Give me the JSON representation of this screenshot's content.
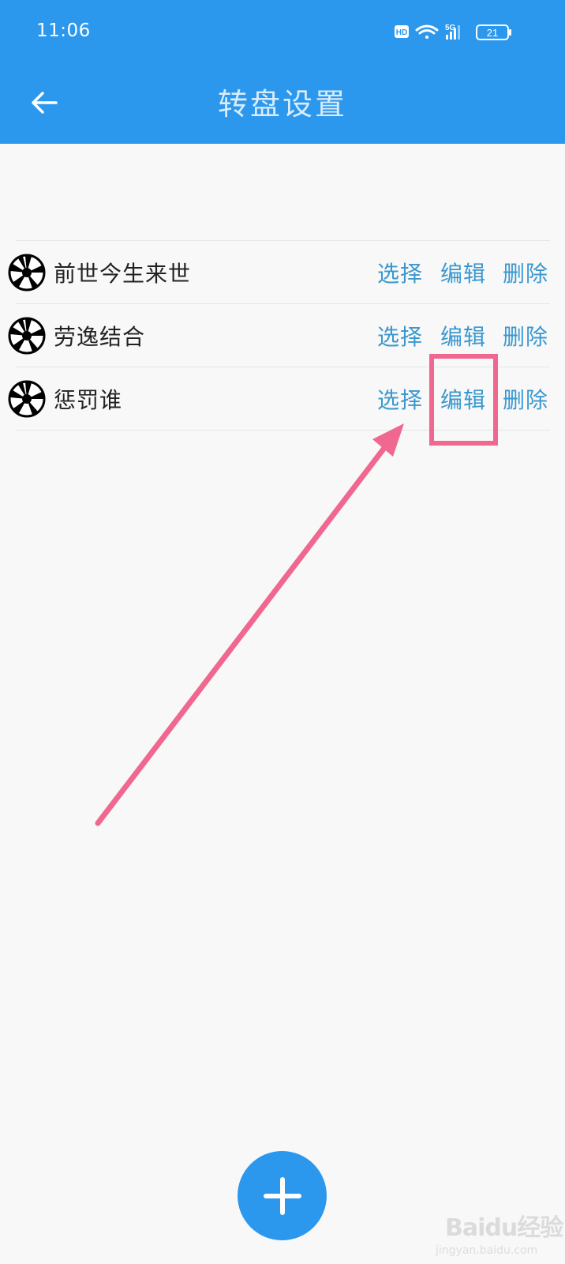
{
  "status_bar": {
    "time": "11:06",
    "hd_badge": "HD",
    "network": "5G",
    "battery": "21",
    "icons": [
      "hd-icon",
      "wifi-icon",
      "signal-icon",
      "battery-icon"
    ]
  },
  "header": {
    "title": "转盘设置",
    "back_icon": "back-arrow-icon",
    "background": "#2b98ee"
  },
  "wheels": [
    {
      "name": "前世今生来世",
      "select": "选择",
      "edit": "编辑",
      "delete": "删除"
    },
    {
      "name": "劳逸结合",
      "select": "选择",
      "edit": "编辑",
      "delete": "删除"
    },
    {
      "name": "惩罚谁",
      "select": "选择",
      "edit": "编辑",
      "delete": "删除"
    }
  ],
  "fab": {
    "icon": "plus-icon"
  },
  "annotation": {
    "color": "#f06790"
  },
  "watermark": {
    "brand": "Baidu经验",
    "url": "jingyan.baidu.com"
  },
  "colors": {
    "accent": "#2b98ee",
    "link": "#3a98cf"
  }
}
